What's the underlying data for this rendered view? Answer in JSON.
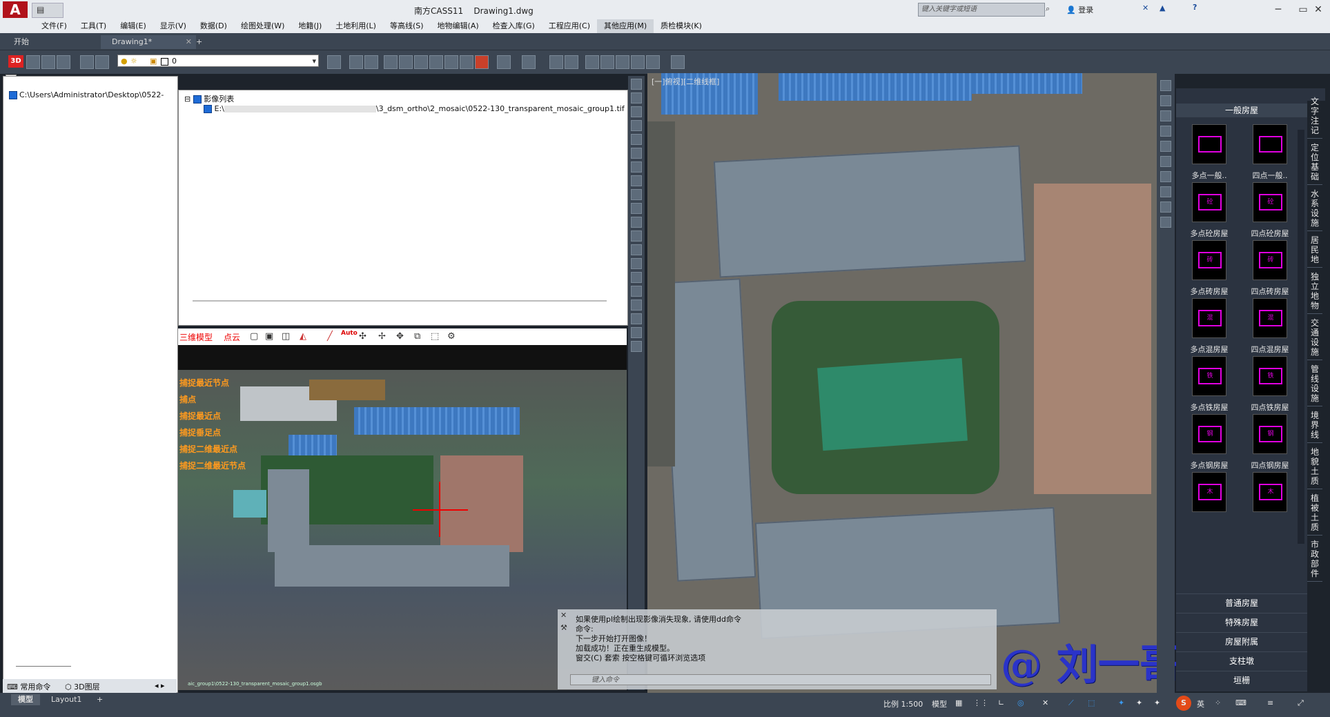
{
  "window": {
    "app_logo": "A",
    "title": "南方CASS11    Drawing1.dwg",
    "search_placeholder": "键入关键字或短语",
    "login_label": "登录",
    "minimize": "─",
    "maximize": "▭",
    "close": "✕"
  },
  "menu": [
    "文件(F)",
    "工具(T)",
    "编辑(E)",
    "显示(V)",
    "数据(D)",
    "绘图处理(W)",
    "地籍(J)",
    "土地利用(L)",
    "等高线(S)",
    "地物编辑(A)",
    "检查入库(G)",
    "工程应用(C)",
    "其他应用(M)",
    "质检模块(K)"
  ],
  "menu_active_index": 12,
  "tabs": {
    "start": "开始",
    "drawing": "Drawing1*",
    "close": "✕",
    "add": "+"
  },
  "toolbar": {
    "btn_3d": "3D",
    "layer_value": "0"
  },
  "left_panel": {
    "collapse": "-",
    "root_path": "C:\\Users\\Administrator\\Desktop\\0522-",
    "tab_commands": "常用命令",
    "tab_layers": "3D图层"
  },
  "image_list": {
    "title": "影像列表",
    "item_prefix": "E:\\",
    "item_path": "\\3_dsm_ortho\\2_mosaic\\0522-130_transparent_mosaic_group1.tif"
  },
  "model_panel": {
    "mode_3d": "三维模型",
    "mode_pointcloud": "点云",
    "auto_btn": "Auto",
    "snap_options": [
      "捕捉最近节点",
      "捕点",
      "捕捉最近点",
      "捕捉垂足点",
      "捕捉二维最近点",
      "捕捉二维最近节点"
    ],
    "footer_path": "aic_group1\\0522-130_transparent_mosaic_group1.osgb"
  },
  "viewport": {
    "label": "[一]俯视][二维线框]"
  },
  "command": {
    "lines": [
      "如果使用pl绘制出现影像消失现象, 请使用dd命令",
      "命令:",
      "下一步开始打开图像！",
      "加载成功！正在重生成模型。",
      "窗交(C) 套索   按空格键可循环浏览选项"
    ],
    "input_placeholder": "键入命令"
  },
  "palette": {
    "header": "一般房屋",
    "items": [
      {
        "label": "多点一般..",
        "glyph": ""
      },
      {
        "label": "四点一般..",
        "glyph": ""
      },
      {
        "label": "多点砼房屋",
        "glyph": "砼"
      },
      {
        "label": "四点砼房屋",
        "glyph": "砼"
      },
      {
        "label": "多点砖房屋",
        "glyph": "砖"
      },
      {
        "label": "四点砖房屋",
        "glyph": "砖"
      },
      {
        "label": "多点混房屋",
        "glyph": "混"
      },
      {
        "label": "四点混房屋",
        "glyph": "混"
      },
      {
        "label": "多点铁房屋",
        "glyph": "铁"
      },
      {
        "label": "四点铁房屋",
        "glyph": "铁"
      },
      {
        "label": "多点钢房屋",
        "glyph": "钢"
      },
      {
        "label": "四点钢房屋",
        "glyph": "钢"
      },
      {
        "label": "",
        "glyph": "木"
      },
      {
        "label": "",
        "glyph": "木"
      }
    ],
    "groups": [
      "普通房屋",
      "特殊房屋",
      "房屋附属",
      "支柱墩",
      "垣栅"
    ],
    "side_tabs": [
      "文字注记",
      "定位基础",
      "水系设施",
      "居民地",
      "独立地物",
      "交通设施",
      "管线设施",
      "境界线",
      "地貌土质",
      "植被土质",
      "市政部件"
    ]
  },
  "watermark": "@ 刘一哥GIS",
  "status": {
    "tab_model": "模型",
    "tab_layout": "Layout1",
    "add": "+",
    "scale": "比例 1:500",
    "model_label": "模型",
    "ime": "英",
    "sogou": "S"
  },
  "colors": {
    "accent_red": "#b1131b",
    "magenta_symbol": "#e000e0",
    "snap_orange": "#ff9a1e",
    "watermark_blue": "#2a33c9"
  }
}
